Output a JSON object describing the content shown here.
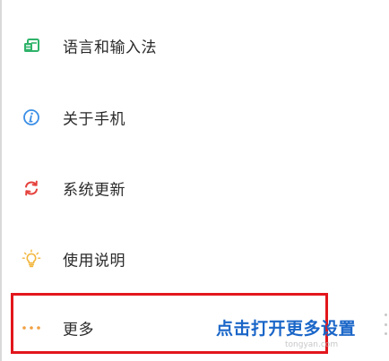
{
  "settings": {
    "items": [
      {
        "label": "语言和输入法",
        "icon": "language-input-icon",
        "icon_color": "#2fb36a"
      },
      {
        "label": "关于手机",
        "icon": "info-icon",
        "icon_color": "#3a8ee6"
      },
      {
        "label": "系统更新",
        "icon": "refresh-icon",
        "icon_color": "#e5413c"
      },
      {
        "label": "使用说明",
        "icon": "lightbulb-icon",
        "icon_color": "#f2b53a"
      },
      {
        "label": "更多",
        "icon": "more-dots-icon",
        "icon_color": "#f0a040"
      }
    ]
  },
  "annotation": {
    "text": "点击打开更多设置",
    "color": "#1a66c8",
    "highlight_color": "#e2161c"
  },
  "watermark": {
    "text": "tongyan.com"
  }
}
